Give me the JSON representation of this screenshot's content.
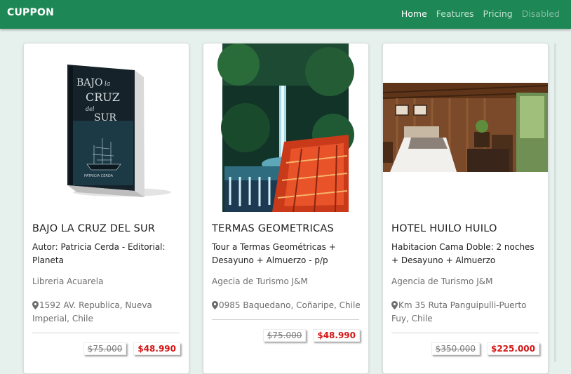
{
  "navbar": {
    "brand": "CUPPON",
    "links": [
      {
        "label": "Home"
      },
      {
        "label": "Features"
      },
      {
        "label": "Pricing"
      },
      {
        "label": "Disabled"
      }
    ]
  },
  "cards": [
    {
      "book_lines": [
        "BAJO",
        "la",
        "CRUZ",
        "del",
        "SUR"
      ],
      "book_author": "PATRICIA CERDA",
      "title": "BAJO LA CRUZ DEL SUR",
      "description": "Autor: Patricia Cerda - Editorial: Planeta",
      "store": "Libreria Acuarela",
      "address": "1592 AV. Republica, Nueva Imperial, Chile",
      "old_price": "$75.000",
      "new_price": "$48.990"
    },
    {
      "title": "TERMAS GEOMETRICAS",
      "description": "Tour a Termas Geométricas + Desayuno + Almuerzo - p/p",
      "store": "Agecia de Turismo J&M",
      "address": "0985 Baquedano, Coñaripe, Chile",
      "old_price": "$75.000",
      "new_price": "$48.990"
    },
    {
      "title": "HOTEL HUILO HUILO",
      "description": "Habitacion Cama Doble: 2 noches + Desayuno + Almuerzo",
      "store": "Agencia de Turismo J&M",
      "address": "Km 35 Ruta Panguipulli-Puerto Fuy, Chile",
      "old_price": "$350.000",
      "new_price": "$225.000"
    }
  ],
  "colors": {
    "navbar": "#1e8756",
    "background": "#e6f0ec",
    "price_new": "#d61515",
    "price_old": "#7a7a7a"
  },
  "icons": {
    "address": "map-marker-icon"
  }
}
